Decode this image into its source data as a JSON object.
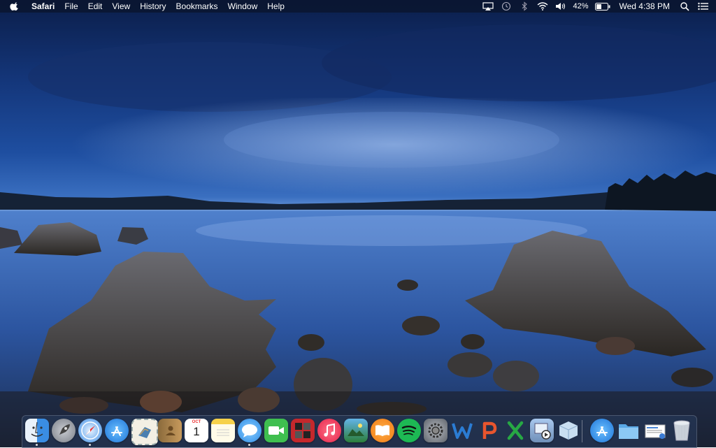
{
  "menubar": {
    "app_name": "Safari",
    "menus": [
      "File",
      "Edit",
      "View",
      "History",
      "Bookmarks",
      "Window",
      "Help"
    ],
    "battery_percent": "42%",
    "clock": "Wed 4:38 PM"
  },
  "dock": {
    "calendar": {
      "month": "OCT",
      "day": "1"
    },
    "items": [
      {
        "name": "Finder",
        "icon": "finder-icon"
      },
      {
        "name": "Launchpad",
        "icon": "rocket-icon"
      },
      {
        "name": "Safari",
        "icon": "compass-icon"
      },
      {
        "name": "App Store",
        "icon": "app-store-icon"
      },
      {
        "name": "Mail",
        "icon": "stamp-icon"
      },
      {
        "name": "Contacts",
        "icon": "contacts-book-icon"
      },
      {
        "name": "Calendar",
        "icon": "calendar-icon"
      },
      {
        "name": "Notes",
        "icon": "notes-icon"
      },
      {
        "name": "Messages",
        "icon": "speech-bubble-icon"
      },
      {
        "name": "FaceTime",
        "icon": "video-camera-icon"
      },
      {
        "name": "Photo Booth",
        "icon": "photo-booth-icon"
      },
      {
        "name": "iTunes",
        "icon": "music-note-icon"
      },
      {
        "name": "iPhoto",
        "icon": "photo-icon"
      },
      {
        "name": "iBooks",
        "icon": "book-icon"
      },
      {
        "name": "Spotify",
        "icon": "spotify-icon"
      },
      {
        "name": "System Preferences",
        "icon": "gear-icon"
      },
      {
        "name": "WPS Writer",
        "icon": "w-letter-icon"
      },
      {
        "name": "WPS Presentation",
        "icon": "p-letter-icon"
      },
      {
        "name": "WPS Spreadsheets",
        "icon": "x-letter-icon"
      },
      {
        "name": "Preview",
        "icon": "preview-icon"
      },
      {
        "name": "Package",
        "icon": "box-icon"
      },
      {
        "name": "Applications",
        "icon": "app-store-folder-icon"
      },
      {
        "name": "Documents",
        "icon": "folder-icon"
      },
      {
        "name": "Downloads",
        "icon": "document-stack-icon"
      },
      {
        "name": "Trash",
        "icon": "trash-icon"
      }
    ]
  },
  "colors": {
    "menubar_bg": "#0a1630",
    "accent_red": "#e83a4a",
    "spotify_green": "#1db954",
    "wps_blue": "#2b7cd3",
    "wps_orange": "#e8552e",
    "wps_green": "#27a844"
  }
}
